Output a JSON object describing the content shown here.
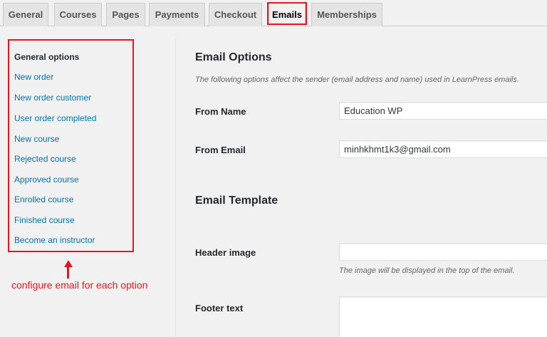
{
  "tabs": [
    {
      "label": "General",
      "active": false
    },
    {
      "label": "Courses",
      "active": false
    },
    {
      "label": "Pages",
      "active": false
    },
    {
      "label": "Payments",
      "active": false
    },
    {
      "label": "Checkout",
      "active": false
    },
    {
      "label": "Emails",
      "active": true
    },
    {
      "label": "Memberships",
      "active": false
    }
  ],
  "sidebar": {
    "items": [
      {
        "label": "General options",
        "current": true
      },
      {
        "label": "New order",
        "current": false
      },
      {
        "label": "New order customer",
        "current": false
      },
      {
        "label": "User order completed",
        "current": false
      },
      {
        "label": "New course",
        "current": false
      },
      {
        "label": "Rejected course",
        "current": false
      },
      {
        "label": "Approved course",
        "current": false
      },
      {
        "label": "Enrolled course",
        "current": false
      },
      {
        "label": "Finished course",
        "current": false
      },
      {
        "label": "Become an instructor",
        "current": false
      }
    ]
  },
  "annotation": {
    "text": "configure email for each option",
    "color": "#e8131d"
  },
  "email_options": {
    "title": "Email Options",
    "description": "The following options affect the sender (email address and name) used in LearnPress emails.",
    "from_name_label": "From Name",
    "from_name_value": "Education WP",
    "from_email_label": "From Email",
    "from_email_value": "minhkhmt1k3@gmail.com"
  },
  "email_template": {
    "title": "Email Template",
    "header_image_label": "Header image",
    "header_image_value": "",
    "header_image_hint": "The image will be displayed in the top of the email.",
    "footer_text_label": "Footer text",
    "footer_text_value": ""
  },
  "colors": {
    "link": "#0073aa",
    "highlight": "#e8131d"
  }
}
